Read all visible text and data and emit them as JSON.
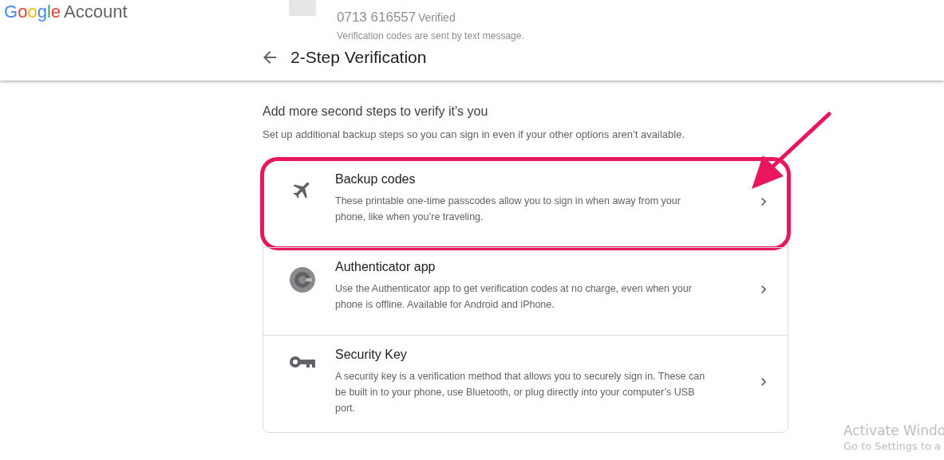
{
  "header": {
    "logo": {
      "brand": "Google",
      "product": "Account"
    },
    "background_item": {
      "phone": "0713 616557",
      "status": "Verified",
      "note": "Verification codes are sent by text message."
    },
    "title": "2-Step Verification"
  },
  "section": {
    "heading": "Add more second steps to verify it's you",
    "subtitle": "Set up additional backup steps so you can sign in even if your other options aren’t available."
  },
  "options": [
    {
      "kind": "plane",
      "title": "Backup codes",
      "description": "These printable one-time passcodes allow you to sign in when away from your phone, like when you’re traveling.",
      "selected": true
    },
    {
      "kind": "authenticator",
      "title": "Authenticator app",
      "description": "Use the Authenticator app to get verification codes at no charge, even when your phone is offline. Available for Android and iPhone.",
      "selected": false
    },
    {
      "kind": "key",
      "title": "Security Key",
      "description": "A security key is a verification method that allows you to securely sign in. These can be built in to your phone, use Bluetooth, or plug directly into your computer’s USB port.",
      "selected": false
    }
  ],
  "os_notice": {
    "title": "Activate Windo",
    "text": "Go to Settings to a"
  }
}
